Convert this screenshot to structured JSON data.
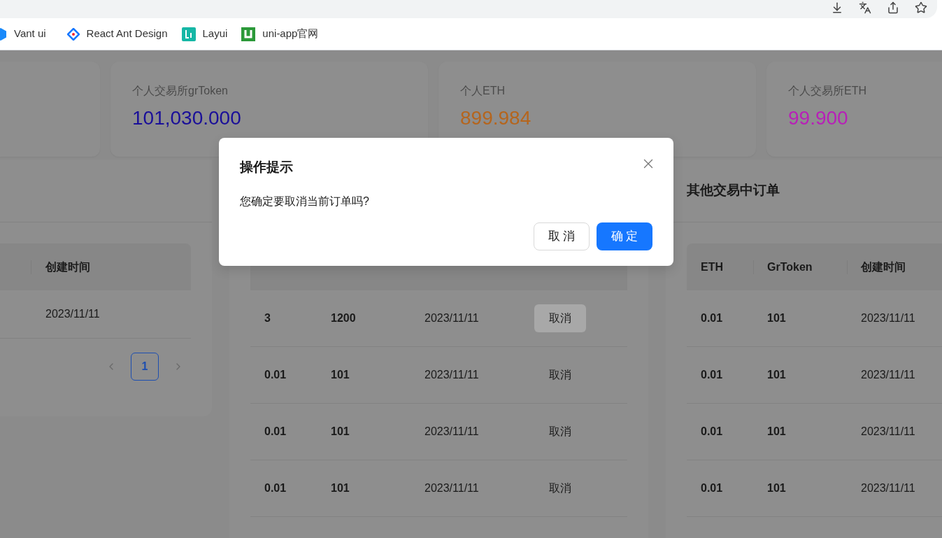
{
  "bookmarks": [
    {
      "label": "Vant ui",
      "kind": "vant"
    },
    {
      "label": "React Ant Design",
      "kind": "antd"
    },
    {
      "label": "Layui",
      "kind": "layui"
    },
    {
      "label": "uni-app官网",
      "kind": "uniapp"
    }
  ],
  "stats": [
    {
      "label": "个人交易所grToken",
      "value": "101,030.000",
      "color": "#1a0f99"
    },
    {
      "label": "个人ETH",
      "value": "899.984",
      "color": "#b5651d"
    },
    {
      "label": "个人交易所ETH",
      "value": "99.900",
      "color": "#b81fb8"
    }
  ],
  "left_panel": {
    "table": {
      "columns": [
        "创建时间"
      ],
      "rows": [
        [
          "2023/11/11"
        ]
      ]
    },
    "pagination": {
      "pages": [
        {
          "label": "1",
          "selected": true
        }
      ]
    }
  },
  "middle_panel": {
    "table": {
      "rows": [
        {
          "cells": [
            "3",
            "1200",
            "2023/11/11"
          ],
          "action": "取消",
          "highlighted": true
        },
        {
          "cells": [
            "0.01",
            "101",
            "2023/11/11"
          ],
          "action": "取消",
          "highlighted": false
        },
        {
          "cells": [
            "0.01",
            "101",
            "2023/11/11"
          ],
          "action": "取消",
          "highlighted": false
        },
        {
          "cells": [
            "0.01",
            "101",
            "2023/11/11"
          ],
          "action": "取消",
          "highlighted": false
        }
      ]
    }
  },
  "right_panel": {
    "title": "其他交易中订单",
    "table": {
      "columns": [
        "ETH",
        "GrToken",
        "创建时间"
      ],
      "rows": [
        [
          "0.01",
          "101",
          "2023/11/11"
        ],
        [
          "0.01",
          "101",
          "2023/11/11"
        ],
        [
          "0.01",
          "101",
          "2023/11/11"
        ],
        [
          "0.01",
          "101",
          "2023/11/11"
        ]
      ]
    }
  },
  "dialog": {
    "title": "操作提示",
    "message": "您确定要取消当前订单吗?",
    "buttons": [
      {
        "label": "取 消",
        "kind": "default"
      },
      {
        "label": "确 定",
        "kind": "primary"
      }
    ]
  }
}
